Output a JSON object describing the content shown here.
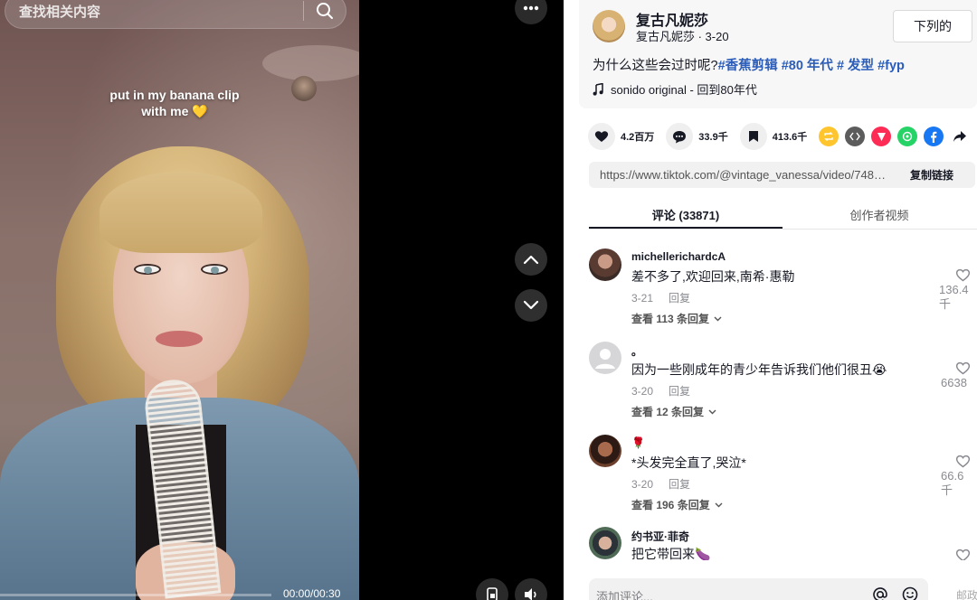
{
  "search": {
    "placeholder": "查找相关内容"
  },
  "video": {
    "caption_line1": "put in my banana clip",
    "caption_line2": "with me 💛",
    "time": "00:00/00:30",
    "progress": 0.0
  },
  "author": {
    "name": "复古凡妮莎",
    "handle_date": "复古凡妮莎 · 3-20",
    "follow_label": "下列的"
  },
  "description": {
    "text": "为什么这些会过时呢?",
    "tags": [
      "#香蕉剪辑",
      "#80 年代",
      "# 发型",
      "#fyp"
    ]
  },
  "music": {
    "label": "sonido original - 回到80年代"
  },
  "actions": {
    "likes": "4.2百万",
    "comments": "33.9千",
    "saves": "413.6千"
  },
  "share_icons": [
    "repost-icon",
    "embed-icon",
    "send-icon",
    "whatsapp-icon",
    "facebook-icon",
    "share-arrow-icon"
  ],
  "link": {
    "url": "https://www.tiktok.com/@vintage_vanessa/video/7483...",
    "copy_label": "复制链接"
  },
  "tabs": [
    {
      "label": "评论 (33871)",
      "active": true
    },
    {
      "label": "创作者视频",
      "active": false
    }
  ],
  "comments": [
    {
      "user": "michellerichardcA",
      "text": "差不多了,欢迎回来,南希·惠勒",
      "date": "3-21",
      "reply": "回复",
      "replies": "查看 113 条回复",
      "likes": "136.4\n千"
    },
    {
      "user": "。",
      "text": "因为一些刚成年的青少年告诉我们他们很丑😭",
      "date": "3-20",
      "reply": "回复",
      "replies": "查看 12 条回复",
      "likes": "6638"
    },
    {
      "user": "🌹",
      "text": "*头发完全直了,哭泣*",
      "date": "3-20",
      "reply": "回复",
      "replies": "查看 196 条回复",
      "likes": "66.6\n千"
    },
    {
      "user": "约书亚·菲奇",
      "text": "把它带回来🍆",
      "date": "",
      "reply": "",
      "replies": "",
      "likes": ""
    }
  ],
  "comment_input": {
    "placeholder": "添加评论...",
    "post_label": "邮政"
  },
  "colors": {
    "tag": "#2b5db9",
    "text": "#161823",
    "muted": "#8a8b91"
  }
}
